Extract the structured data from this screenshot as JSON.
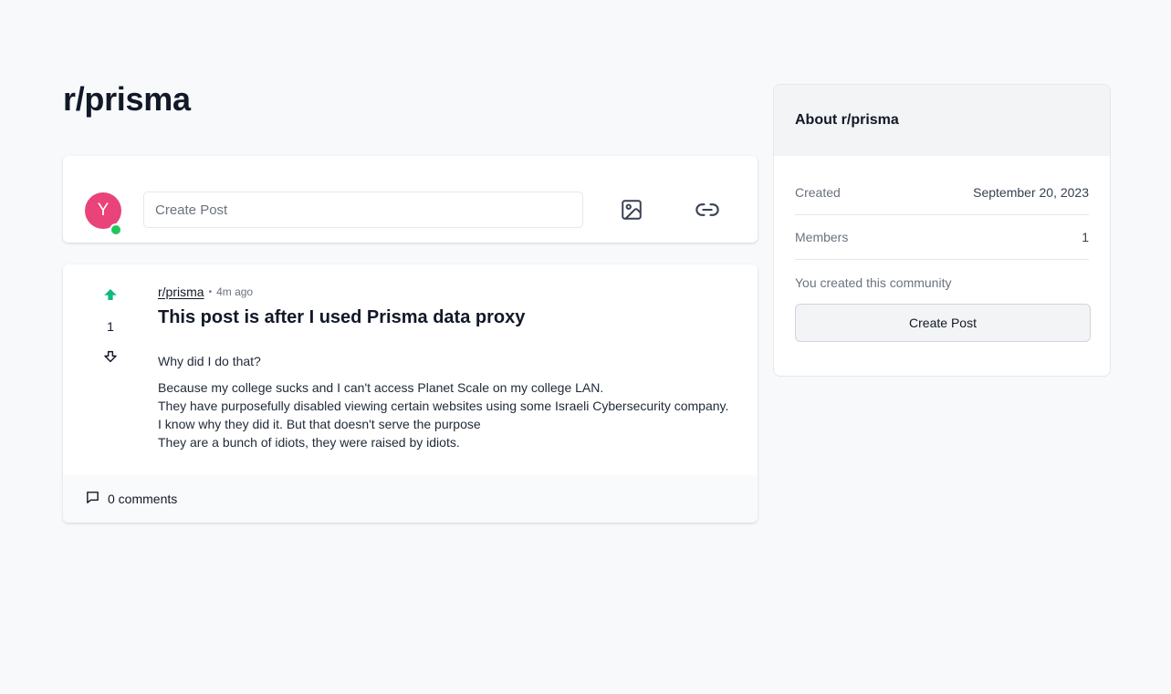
{
  "page": {
    "title": "r/prisma"
  },
  "composer": {
    "avatar_initial": "Y",
    "input_placeholder": "Create Post",
    "image_icon": "image-icon",
    "link_icon": "link-icon"
  },
  "post": {
    "subreddit": "r/prisma",
    "separator": "•",
    "time_ago": "4m ago",
    "votes": "1",
    "title": "This post is after I used Prisma data proxy",
    "intro": "Why did I do that?",
    "lines": [
      "Because my college sucks and I can't access Planet Scale on my college LAN.",
      "They have purposefully disabled viewing certain websites using some Israeli Cybersecurity company.",
      "I know why they did it. But that doesn't serve the purpose",
      "They are a bunch of idiots, they were raised by idiots."
    ],
    "comments_label": "0 comments",
    "upvote_color": "#10b981"
  },
  "sidebar": {
    "header": "About r/prisma",
    "rows": [
      {
        "label": "Created",
        "value": "September 20, 2023"
      },
      {
        "label": "Members",
        "value": "1"
      }
    ],
    "note": "You created this community",
    "button_label": "Create Post"
  },
  "colors": {
    "avatar": "#e9437a",
    "online": "#22c55e",
    "background": "#f8f9fb"
  }
}
